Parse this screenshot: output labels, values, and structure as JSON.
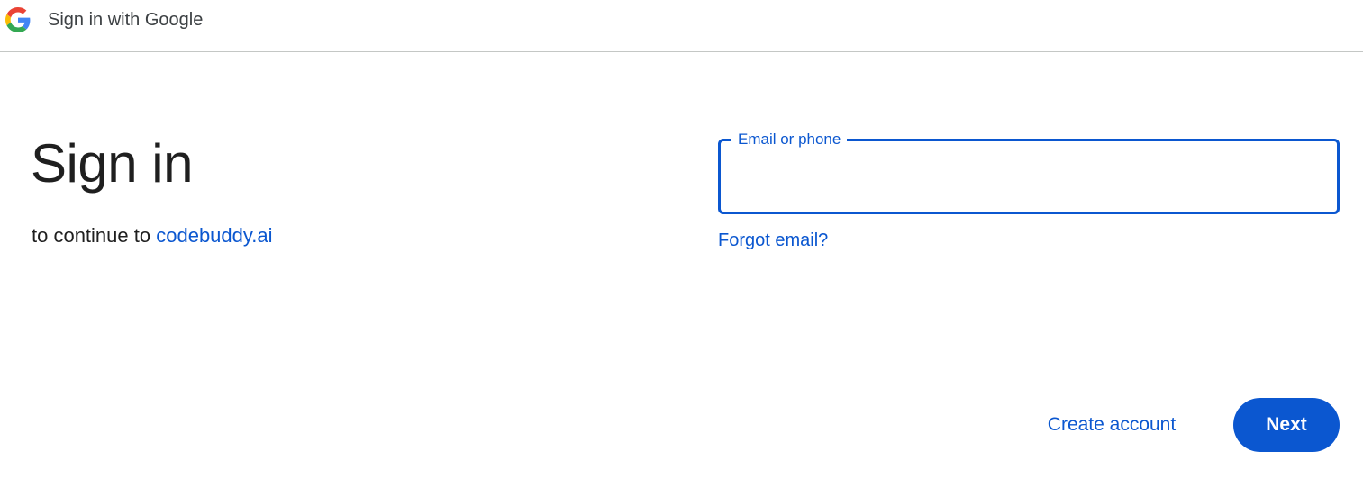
{
  "header": {
    "title": "Sign in with Google",
    "logo_icon": "google-g-icon"
  },
  "main": {
    "heading": "Sign in",
    "subtitle_prefix": "to continue to",
    "app_name": "codebuddy.ai"
  },
  "form": {
    "email_label": "Email or phone",
    "email_value": "",
    "forgot_email": "Forgot email?"
  },
  "actions": {
    "create_account": "Create account",
    "next": "Next"
  },
  "colors": {
    "accent": "#0b57d0",
    "text": "#1f1f1f",
    "divider": "#c4c7c5"
  }
}
